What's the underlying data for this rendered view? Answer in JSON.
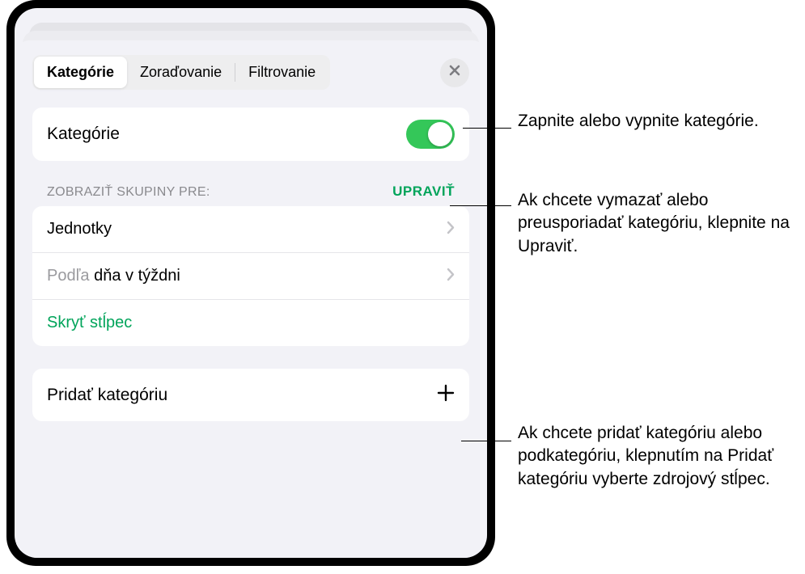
{
  "tabs": {
    "categories": "Kategórie",
    "sorting": "Zoraďovanie",
    "filtering": "Filtrovanie"
  },
  "toggle": {
    "label": "Kategórie",
    "on": true
  },
  "section": {
    "title": "Zobraziť skupiny pre:",
    "edit": "Upraviť"
  },
  "rows": {
    "units": "Jednotky",
    "byday_prefix": "Podľa ",
    "byday_accent": "dňa v týždni",
    "hidecol": "Skryť stĺpec"
  },
  "add": {
    "label": "Pridať kategóriu"
  },
  "callouts": {
    "toggle": "Zapnite alebo vypnite kategórie.",
    "edit": "Ak chcete vymazať alebo preusporiadať kategóriu, klepnite na Upraviť.",
    "add": "Ak chcete pridať kategóriu alebo podkategóriu, klepnutím na Pridať kategóriu vyberte zdrojový stĺpec."
  }
}
